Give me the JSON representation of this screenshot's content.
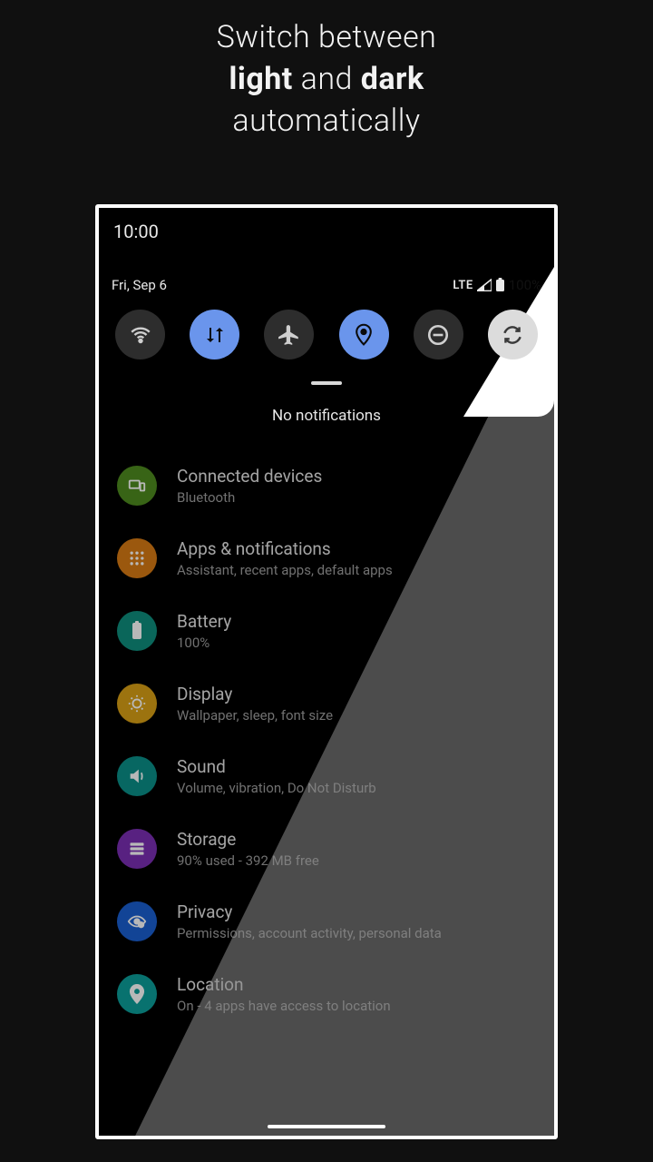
{
  "headline": {
    "line1": "Switch between",
    "bold1": "light",
    "mid": " and ",
    "bold2": "dark",
    "line3": "automatically"
  },
  "time": "10:00",
  "status": {
    "date": "Fri, Sep 6",
    "network": "LTE",
    "battery_pct": "100%"
  },
  "qs": {
    "tiles": [
      {
        "name": "wifi",
        "active": false
      },
      {
        "name": "data",
        "active": true
      },
      {
        "name": "airplane",
        "active": false
      },
      {
        "name": "location",
        "active": true
      },
      {
        "name": "dnd",
        "active": false
      },
      {
        "name": "autorotate",
        "active": false,
        "light": true
      }
    ]
  },
  "notifications": {
    "empty_text": "No notifications"
  },
  "settings": [
    {
      "icon": "devices",
      "color": "ic-green",
      "title": "Connected devices",
      "sub": "Bluetooth"
    },
    {
      "icon": "apps",
      "color": "ic-orange",
      "title": "Apps & notifications",
      "sub": "Assistant, recent apps, default apps"
    },
    {
      "icon": "battery",
      "color": "ic-teal",
      "title": "Battery",
      "sub": "100%"
    },
    {
      "icon": "display",
      "color": "ic-yellow",
      "title": "Display",
      "sub": "Wallpaper, sleep, font size"
    },
    {
      "icon": "sound",
      "color": "ic-teal2",
      "title": "Sound",
      "sub": "Volume, vibration, Do Not Disturb"
    },
    {
      "icon": "storage",
      "color": "ic-purple",
      "title": "Storage",
      "sub": "90% used - 392 MB free"
    },
    {
      "icon": "privacy",
      "color": "ic-blue",
      "title": "Privacy",
      "sub": "Permissions, account activity, personal data"
    },
    {
      "icon": "location",
      "color": "ic-tealLoc",
      "title": "Location",
      "sub": "On - 4 apps have access to location"
    }
  ]
}
